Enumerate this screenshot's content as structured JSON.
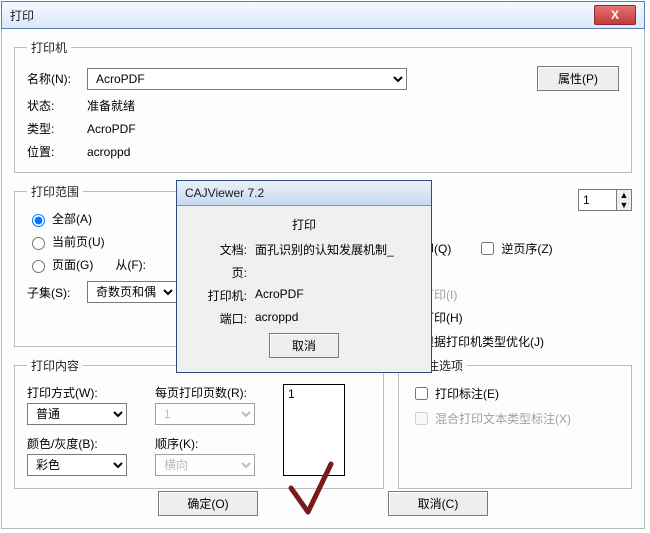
{
  "title": "打印",
  "close_x": "X",
  "printer": {
    "legend": "打印机",
    "name_label": "名称(N):",
    "name_value": "AcroPDF",
    "props_btn": "属性(P)",
    "status_label": "状态:",
    "status_value": "准备就绪",
    "type_label": "类型:",
    "type_value": "AcroPDF",
    "location_label": "位置:",
    "location_value": "acroppd"
  },
  "range": {
    "legend": "打印范围",
    "all": "全部(A)",
    "current": "当前页(U)",
    "pages": "页面(G)",
    "from_label": "从(F):",
    "subset_label": "子集(S):",
    "subset_value": "奇数页和偶"
  },
  "content": {
    "legend": "打印内容",
    "method_label": "打印方式(W):",
    "method_value": "普通",
    "per_sheet_label": "每页打印页数(R):",
    "per_sheet_value": "1",
    "color_label": "颜色/灰度(B):",
    "color_value": "彩色",
    "order_label": "顺序(K):",
    "order_value": "横向",
    "preview_thumb": "1"
  },
  "copies": {
    "count": "1",
    "collate": "印(Q)",
    "reverse": "逆页序(Z)"
  },
  "page_option": {
    "as_image_i": "方式打印(I)",
    "as_image_h": "方式打印(H)",
    "optimize": "根据打印机类型优化(J)"
  },
  "annot": {
    "legend": "标注选项",
    "print_annot": "打印标注(E)",
    "mix_text": "混合打印文本类型标注(X)"
  },
  "ok_btn": "确定(O)",
  "cancel_btn": "取消(C)",
  "modal": {
    "title": "CAJViewer 7.2",
    "heading": "打印",
    "doc_label": "文档:",
    "doc_value": "面孔识别的认知发展机制_",
    "page_label": "页:",
    "printer_label": "打印机:",
    "printer_value": "AcroPDF",
    "port_label": "端口:",
    "port_value": "acroppd",
    "cancel": "取消"
  }
}
